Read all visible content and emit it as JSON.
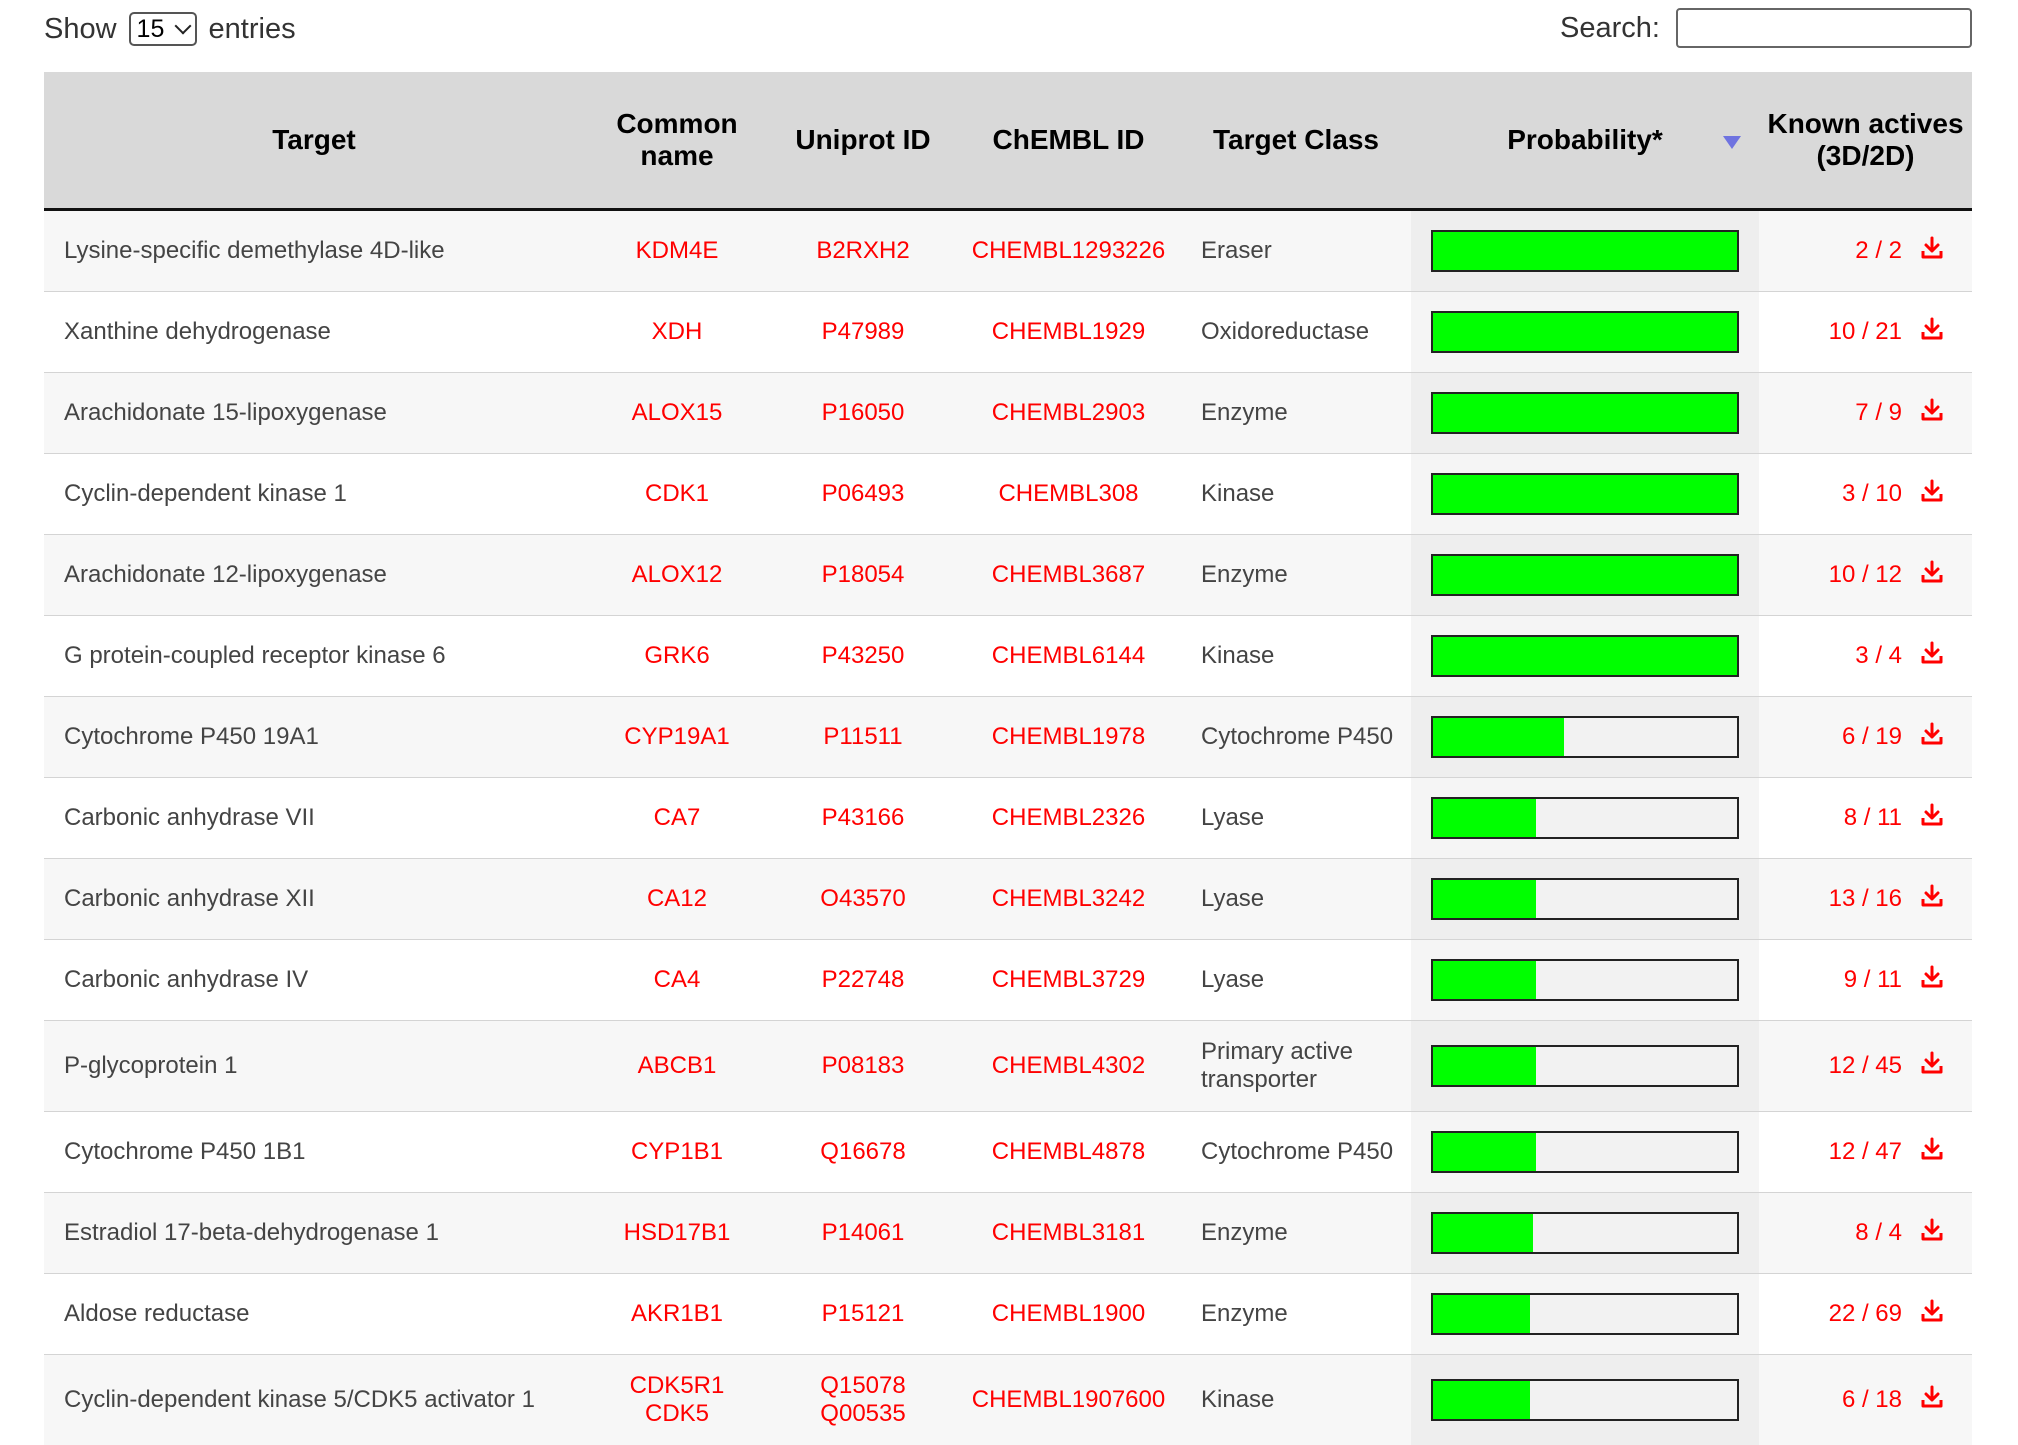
{
  "controls": {
    "show_label": "Show",
    "entries_value": "15",
    "entries_label": "entries",
    "search_label": "Search:",
    "search_value": ""
  },
  "table": {
    "headers": {
      "target": "Target",
      "common_name": "Common name",
      "uniprot": "Uniprot ID",
      "chembl": "ChEMBL ID",
      "target_class": "Target Class",
      "probability": "Probability*",
      "known_actives": "Known actives (3D/2D)"
    },
    "sorted_column": "probability",
    "sort_direction": "descending",
    "rows": [
      {
        "target": "Lysine-specific demethylase 4D-like",
        "common": "KDM4E",
        "uniprot": "B2RXH2",
        "chembl": "CHEMBL1293226",
        "cls": "Eraser",
        "prob": 1.0,
        "known": "2 / 2"
      },
      {
        "target": "Xanthine dehydrogenase",
        "common": "XDH",
        "uniprot": "P47989",
        "chembl": "CHEMBL1929",
        "cls": "Oxidoreductase",
        "prob": 1.0,
        "known": "10 / 21"
      },
      {
        "target": "Arachidonate 15-lipoxygenase",
        "common": "ALOX15",
        "uniprot": "P16050",
        "chembl": "CHEMBL2903",
        "cls": "Enzyme",
        "prob": 1.0,
        "known": "7 / 9"
      },
      {
        "target": "Cyclin-dependent kinase 1",
        "common": "CDK1",
        "uniprot": "P06493",
        "chembl": "CHEMBL308",
        "cls": "Kinase",
        "prob": 1.0,
        "known": "3 / 10"
      },
      {
        "target": "Arachidonate 12-lipoxygenase",
        "common": "ALOX12",
        "uniprot": "P18054",
        "chembl": "CHEMBL3687",
        "cls": "Enzyme",
        "prob": 1.0,
        "known": "10 / 12"
      },
      {
        "target": "G protein-coupled receptor kinase 6",
        "common": "GRK6",
        "uniprot": "P43250",
        "chembl": "CHEMBL6144",
        "cls": "Kinase",
        "prob": 1.0,
        "known": "3 / 4"
      },
      {
        "target": "Cytochrome P450 19A1",
        "common": "CYP19A1",
        "uniprot": "P11511",
        "chembl": "CHEMBL1978",
        "cls": "Cytochrome P450",
        "prob": 0.43,
        "known": "6 / 19"
      },
      {
        "target": "Carbonic anhydrase VII",
        "common": "CA7",
        "uniprot": "P43166",
        "chembl": "CHEMBL2326",
        "cls": "Lyase",
        "prob": 0.34,
        "known": "8 / 11"
      },
      {
        "target": "Carbonic anhydrase XII",
        "common": "CA12",
        "uniprot": "O43570",
        "chembl": "CHEMBL3242",
        "cls": "Lyase",
        "prob": 0.34,
        "known": "13 / 16"
      },
      {
        "target": "Carbonic anhydrase IV",
        "common": "CA4",
        "uniprot": "P22748",
        "chembl": "CHEMBL3729",
        "cls": "Lyase",
        "prob": 0.34,
        "known": "9 / 11"
      },
      {
        "target": "P-glycoprotein 1",
        "common": "ABCB1",
        "uniprot": "P08183",
        "chembl": "CHEMBL4302",
        "cls": "Primary active transporter",
        "prob": 0.34,
        "known": "12 / 45"
      },
      {
        "target": "Cytochrome P450 1B1",
        "common": "CYP1B1",
        "uniprot": "Q16678",
        "chembl": "CHEMBL4878",
        "cls": "Cytochrome P450",
        "prob": 0.34,
        "known": "12 / 47"
      },
      {
        "target": "Estradiol 17-beta-dehydrogenase 1",
        "common": "HSD17B1",
        "uniprot": "P14061",
        "chembl": "CHEMBL3181",
        "cls": "Enzyme",
        "prob": 0.33,
        "known": "8 / 4"
      },
      {
        "target": "Aldose reductase",
        "common": "AKR1B1",
        "uniprot": "P15121",
        "chembl": "CHEMBL1900",
        "cls": "Enzyme",
        "prob": 0.32,
        "known": "22 / 69"
      },
      {
        "target": "Cyclin-dependent kinase 5/CDK5 activator 1",
        "common": "CDK5R1\nCDK5",
        "uniprot": "Q15078\nQ00535",
        "chembl": "CHEMBL1907600",
        "cls": "Kinase",
        "prob": 0.32,
        "known": "6 / 18"
      }
    ]
  },
  "colors": {
    "link": "#ff0000",
    "bar_fill": "#00ff00",
    "header_bg": "#d9d9d9",
    "sort_arrow": "#6f73e0"
  },
  "icons": {
    "download": "download-icon",
    "sort": "sort-desc-icon",
    "dropdown": "chevron-down-icon"
  }
}
